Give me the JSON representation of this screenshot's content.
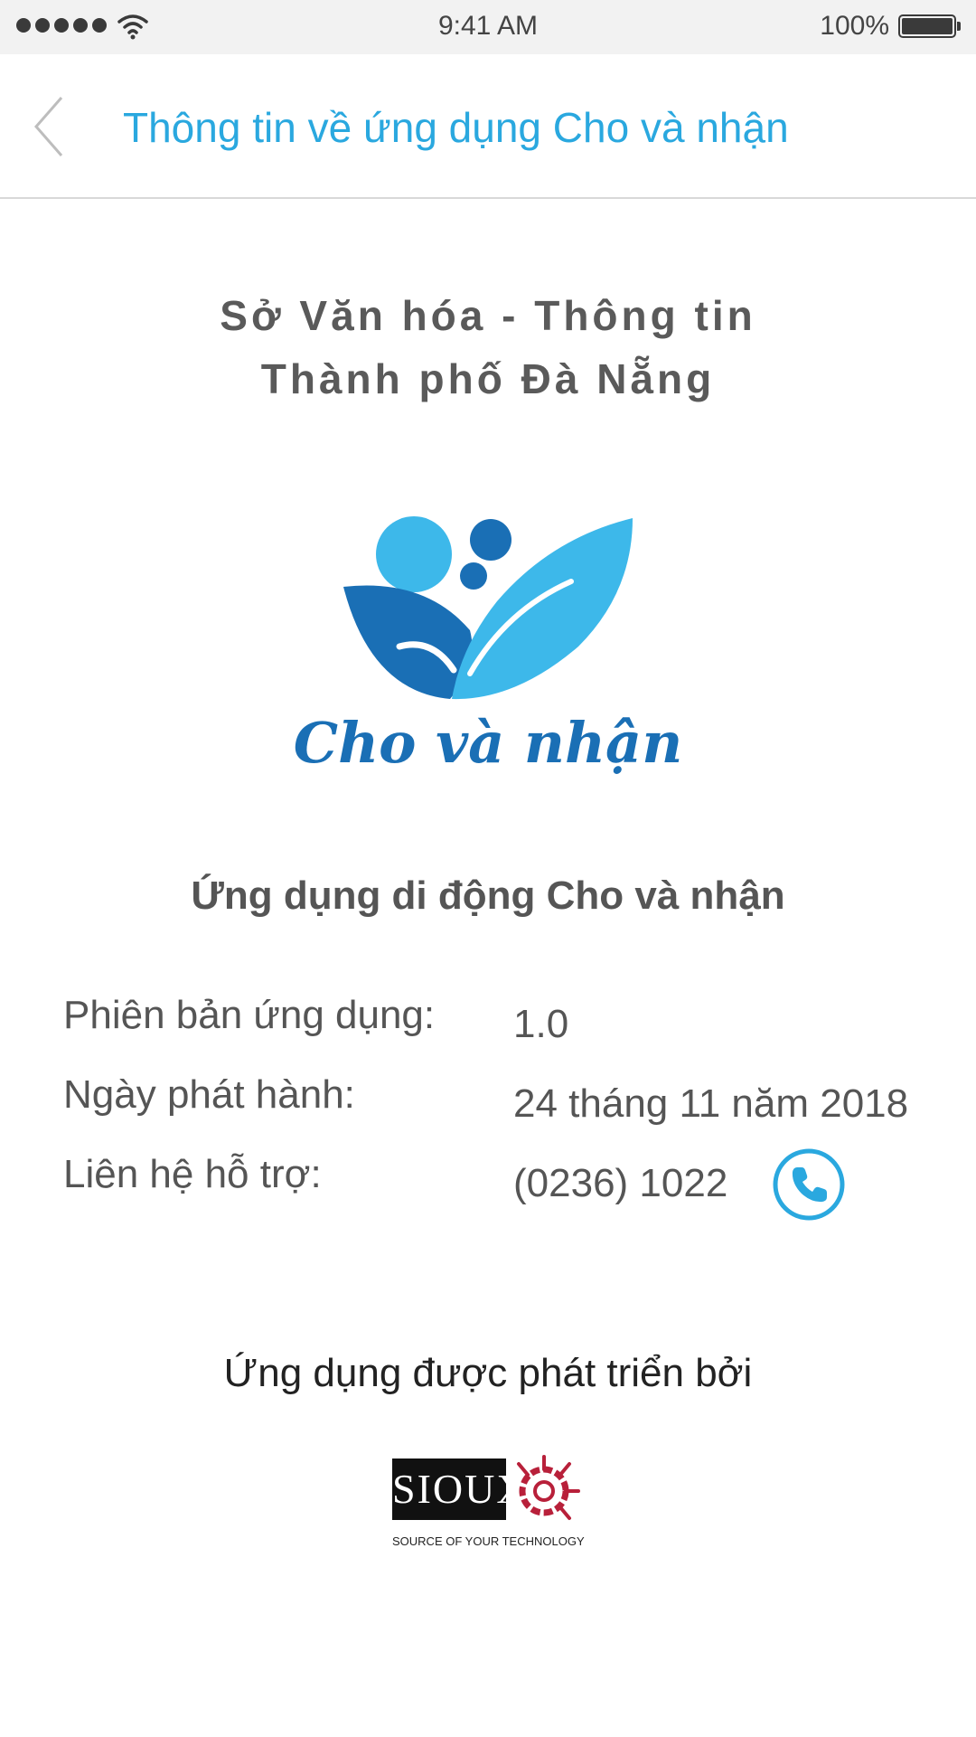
{
  "status_bar": {
    "time": "9:41 AM",
    "battery_percent": "100%",
    "battery_level": 1.0,
    "signal_bars": 5
  },
  "header": {
    "title": "Thông tin về ứng dụng Cho và nhận",
    "back_icon": "chevron-left-icon",
    "title_color": "#2aa8df"
  },
  "organization": {
    "line1": "Sở Văn hóa - Thông tin",
    "line2": "Thành phố Đà Nẵng"
  },
  "logo": {
    "text": "Cho và nhận",
    "colors": {
      "light_blue": "#3db8ea",
      "dark_blue": "#1a6fb5"
    }
  },
  "app": {
    "name": "Ứng dụng di động Cho và nhận"
  },
  "info": {
    "version_label": "Phiên bản ứng dụng:",
    "version_value": "1.0",
    "release_label": "Ngày phát hành:",
    "release_value": "24 tháng 11 năm 2018",
    "support_label": "Liên hệ hỗ trợ:",
    "support_value": "(0236) 1022",
    "phone_icon": "phone-icon"
  },
  "developer": {
    "label": "Ứng dụng được phát triển bởi",
    "logo_text": "SIOUX",
    "tagline": "SOURCE OF YOUR TECHNOLOGY",
    "brand_color": "#b8203a"
  }
}
